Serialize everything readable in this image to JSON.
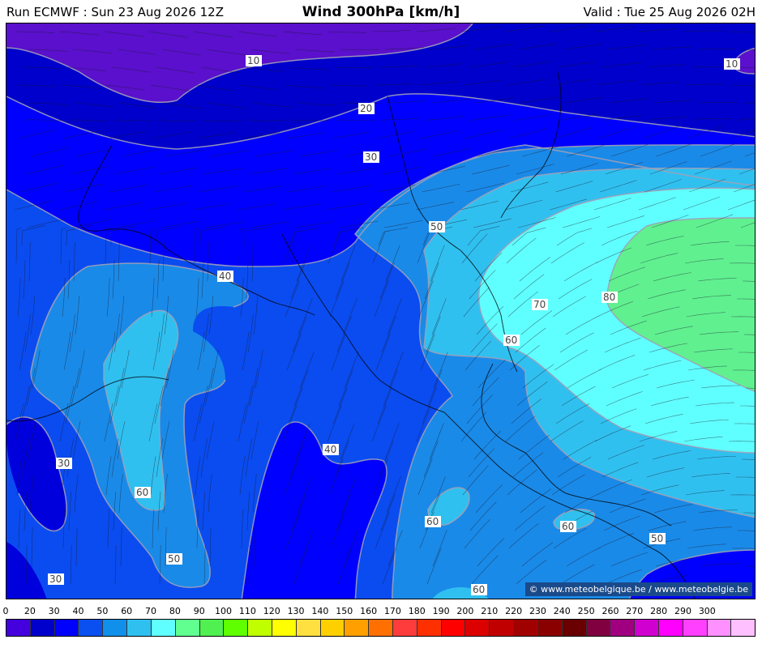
{
  "header": {
    "run": "Run ECMWF : Sun 23 Aug 2026 12Z",
    "title": "Wind 300hPa [km/h]",
    "valid": "Valid : Tue 25 Aug 2026 02H"
  },
  "map": {
    "copyright": "© www.meteobelgique.be / www.meteobelgie.be",
    "contour_labels": [
      "10",
      "10",
      "20",
      "30",
      "40",
      "40",
      "50",
      "50",
      "50",
      "60",
      "60",
      "60",
      "60",
      "60",
      "70",
      "80",
      "30",
      "30"
    ],
    "palette_by_speed": {
      "0": "#4400dd",
      "10": "#5a10cc",
      "20": "#0000cc",
      "30": "#0000ff",
      "40": "#0a4cf0",
      "50": "#1a8ae8",
      "60": "#30c0f0",
      "70": "#60ffff",
      "80": "#60f090"
    }
  },
  "legend": {
    "ticks": [
      "0",
      "20",
      "30",
      "40",
      "50",
      "60",
      "70",
      "80",
      "90",
      "100",
      "110",
      "120",
      "130",
      "140",
      "150",
      "160",
      "170",
      "180",
      "190",
      "200",
      "210",
      "220",
      "230",
      "240",
      "250",
      "260",
      "270",
      "280",
      "290",
      "300"
    ],
    "colors": [
      "#4400dd",
      "#0000cc",
      "#0000ff",
      "#0a50f0",
      "#1090ea",
      "#30c0f0",
      "#60ffff",
      "#60ff90",
      "#50f050",
      "#60ff00",
      "#c0ff00",
      "#ffff00",
      "#ffe040",
      "#ffd000",
      "#ffa000",
      "#ff7000",
      "#ff3c3c",
      "#ff3000",
      "#ff0000",
      "#dd0000",
      "#c00000",
      "#a00000",
      "#8a0000",
      "#6a0000",
      "#800040",
      "#a00080",
      "#d000d0",
      "#ff00ff",
      "#ff40ff",
      "#ff90ff",
      "#ffc0ff"
    ]
  }
}
